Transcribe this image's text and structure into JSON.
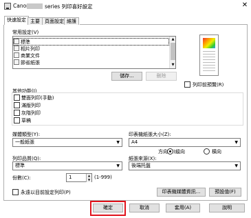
{
  "window": {
    "title_left": "Canon",
    "title_right": "series 列印喜好設定",
    "close_glyph": "✕"
  },
  "tabs": [
    {
      "label": "快速設定"
    },
    {
      "label": "主要"
    },
    {
      "label": "頁面設定"
    },
    {
      "label": "維護"
    }
  ],
  "common_settings": {
    "label": "常用設定(V)",
    "items": [
      {
        "label": "標準",
        "icon": "standard-icon"
      },
      {
        "label": "相片列印",
        "icon": "photo-icon"
      },
      {
        "label": "商業文件",
        "icon": "business-doc-icon"
      },
      {
        "label": "節省紙張",
        "icon": "paper-saving-icon"
      }
    ],
    "save_button": "儲存...",
    "delete_button": "刪除"
  },
  "preview": {
    "always_preview_label": "列印前預覽(R)"
  },
  "additional_features": {
    "label": "其他功能(I)",
    "items": [
      {
        "label": "雙面列印(手動)"
      },
      {
        "label": "滿版列印"
      },
      {
        "label": "灰階列印"
      },
      {
        "label": "草稿"
      }
    ]
  },
  "media_type": {
    "label": "媒體類型(Y):",
    "value": "一般紙張"
  },
  "paper_size": {
    "label": "印表機紙張大小(Z):",
    "value": "A4"
  },
  "orientation": {
    "label": "方向(N):",
    "portrait": "縱向",
    "landscape": "橫向",
    "selected": "portrait"
  },
  "print_quality": {
    "label": "列印品質(Q):",
    "value": "標準"
  },
  "paper_source": {
    "label": "紙張來源(X):",
    "value": "後端托盤"
  },
  "copies": {
    "label": "份數(C):",
    "value": "1",
    "range": "(1-999)"
  },
  "always_print_label": "永遠以目前設定列印(P)",
  "printer_media_info_button": "印表機媒體資訊...",
  "defaults_button": "預設值(F)",
  "footer": {
    "ok": "確定",
    "cancel": "取消",
    "apply": "套用(A)",
    "help": "說明"
  }
}
